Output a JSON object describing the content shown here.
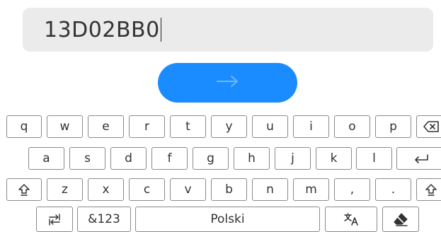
{
  "input": {
    "value": "13D02BB0"
  },
  "submit": {
    "icon": "arrow-right-icon",
    "color": "#1a8cff"
  },
  "keyboard": {
    "row1": [
      "q",
      "w",
      "e",
      "r",
      "t",
      "y",
      "u",
      "i",
      "o",
      "p"
    ],
    "row2": [
      "a",
      "s",
      "d",
      "f",
      "g",
      "h",
      "j",
      "k",
      "l"
    ],
    "row3": [
      "z",
      "x",
      "c",
      "v",
      "b",
      "n",
      "m",
      ",",
      "."
    ],
    "symbols_label": "&123",
    "space_label": "Polski",
    "icons": {
      "backspace": "backspace-icon",
      "enter": "enter-icon",
      "shift": "shift-icon",
      "switch_layout": "switch-layout-icon",
      "translate": "translate-icon",
      "clear": "eraser-icon"
    }
  }
}
